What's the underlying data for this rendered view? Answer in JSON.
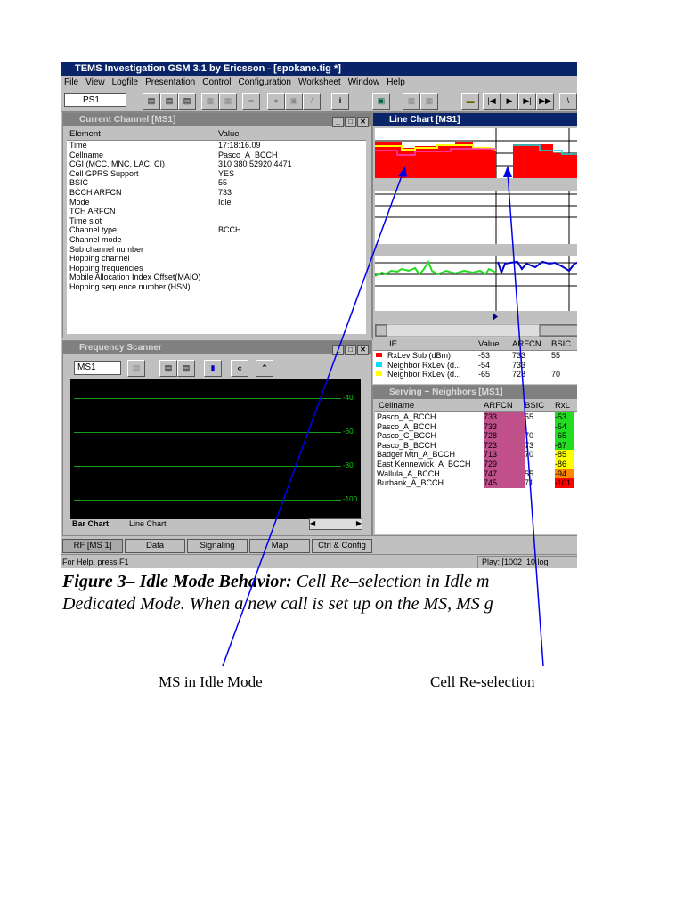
{
  "app": {
    "title": "TEMS Investigation GSM 3.1 by Ericsson - [spokane.tig *]",
    "menu": [
      "File",
      "View",
      "Logfile",
      "Presentation",
      "Control",
      "Configuration",
      "Worksheet",
      "Window",
      "Help"
    ],
    "device_select": "PS1"
  },
  "current_channel": {
    "title": "Current Channel [MS1]",
    "headers": [
      "Element",
      "Value"
    ],
    "rows": [
      [
        "Time",
        "17:18:16.09"
      ],
      [
        "Cellname",
        "Pasco_A_BCCH"
      ],
      [
        "CGI (MCC, MNC, LAC, CI)",
        "310 380 52920 4471"
      ],
      [
        "Cell GPRS Support",
        "YES"
      ],
      [
        "BSIC",
        "55"
      ],
      [
        "BCCH ARFCN",
        "733"
      ],
      [
        "Mode",
        "Idle"
      ],
      [
        "TCH ARFCN",
        ""
      ],
      [
        "Time slot",
        ""
      ],
      [
        "Channel type",
        "BCCH"
      ],
      [
        "Channel mode",
        ""
      ],
      [
        "Sub channel number",
        ""
      ],
      [
        "Hopping channel",
        ""
      ],
      [
        "Hopping frequencies",
        ""
      ],
      [
        "Mobile Allocation Index Offset(MAIO)",
        ""
      ],
      [
        "Hopping sequence number (HSN)",
        ""
      ]
    ]
  },
  "line_chart": {
    "title": "Line Chart [MS1]",
    "legend_headers": [
      "IE",
      "Value",
      "ARFCN",
      "BSIC"
    ],
    "legend": [
      {
        "ie": "RxLev Sub (dBm)",
        "value": "-53",
        "arfcn": "733",
        "bsic": "55",
        "color": "#ff0000"
      },
      {
        "ie": "Neighbor RxLev (d...",
        "value": "-54",
        "arfcn": "733",
        "bsic": "",
        "color": "#00e0ff"
      },
      {
        "ie": "Neighbor RxLev (d...",
        "value": "-65",
        "arfcn": "728",
        "bsic": "70",
        "color": "#ffff00"
      }
    ]
  },
  "serving_neighbors": {
    "title": "Serving + Neighbors [MS1]",
    "headers": [
      "Cellname",
      "ARFCN",
      "BSIC",
      "RxL"
    ],
    "rows": [
      [
        "Pasco_A_BCCH",
        "733",
        "55",
        "-53",
        "#22dd22"
      ],
      [
        "Pasco_A_BCCH",
        "733",
        "",
        "-54",
        "#22dd22"
      ],
      [
        "Pasco_C_BCCH",
        "728",
        "70",
        "-65",
        "#22dd22"
      ],
      [
        "Pasco_B_BCCH",
        "723",
        "73",
        "-67",
        "#22dd22"
      ],
      [
        "Badger Mtn_A_BCCH",
        "713",
        "70",
        "-85",
        "#ffff00"
      ],
      [
        "East Kennewick_A_BCCH",
        "729",
        "",
        "-86",
        "#ffff00"
      ],
      [
        "Wallula_A_BCCH",
        "747",
        "55",
        "-94",
        "#ff8800"
      ],
      [
        "Burbank_A_BCCH",
        "745",
        "71",
        "-101",
        "#ff0000"
      ]
    ]
  },
  "frequency_scanner": {
    "title": "Frequency Scanner",
    "ms_select": "MS1",
    "levels": [
      "-40",
      "-60",
      "-80",
      "-100"
    ],
    "tabs": [
      "Bar Chart",
      "Line Chart"
    ]
  },
  "worksheet_tabs": [
    "RF [MS 1]",
    "Data",
    "Signaling",
    "Map",
    "Ctrl & Config"
  ],
  "status": {
    "help": "For Help, press F1",
    "play": "Play: [1002_10.log"
  },
  "caption": {
    "bold": "Figure 3– Idle Mode Behavior:",
    "line1": " Cell Re–selection in Idle m",
    "line2": "Dedicated Mode. When a new call is set up on the MS, MS g"
  },
  "annotations": {
    "left": "MS in Idle Mode",
    "right": "Cell Re-selection"
  }
}
